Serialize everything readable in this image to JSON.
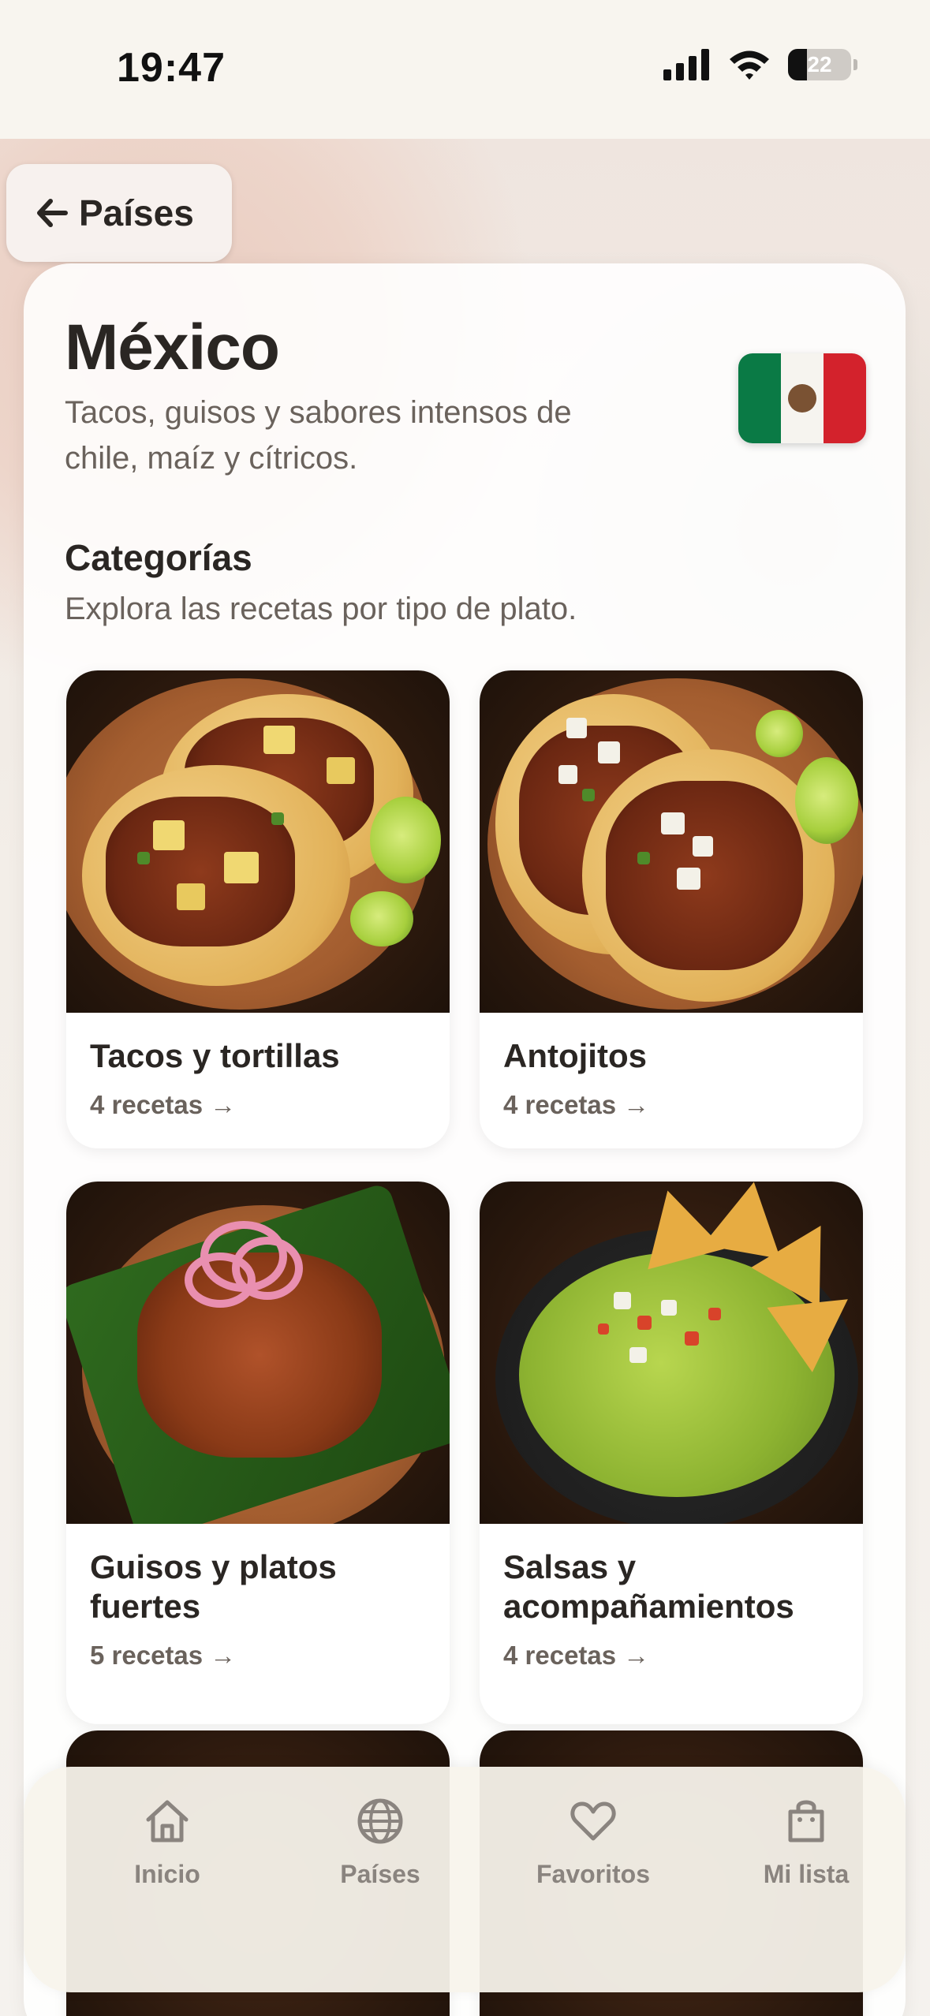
{
  "status_bar": {
    "time": "19:47",
    "battery": "22",
    "icons": [
      "cellular-signal-icon",
      "wifi-icon",
      "battery-icon"
    ]
  },
  "back_button": {
    "label": "Países",
    "icon": "arrow-left-icon"
  },
  "country": {
    "title": "México",
    "subtitle": "Tacos, guisos y sabores intensos de chile, maíz y cítricos.",
    "flag": "mexico-flag",
    "flag_colors": [
      "#0a7a45",
      "#f6f4ef",
      "#d3222c"
    ]
  },
  "categories_section": {
    "title": "Categorías",
    "subtitle": "Explora las recetas por tipo de plato."
  },
  "categories": [
    {
      "title": "Tacos y tortillas",
      "count": "4 recetas →"
    },
    {
      "title": "Antojitos",
      "count": "4 recetas →"
    },
    {
      "title": "Guisos y platos fuertes",
      "count": "5 recetas →"
    },
    {
      "title": "Salsas y acompañamientos",
      "count": "4 recetas →"
    }
  ],
  "bottom_nav": {
    "items": [
      {
        "label": "Inicio",
        "icon": "home-icon"
      },
      {
        "label": "Países",
        "icon": "globe-icon"
      },
      {
        "label": "Favoritos",
        "icon": "heart-icon"
      },
      {
        "label": "Mi lista",
        "icon": "shopping-bag-icon"
      }
    ]
  }
}
